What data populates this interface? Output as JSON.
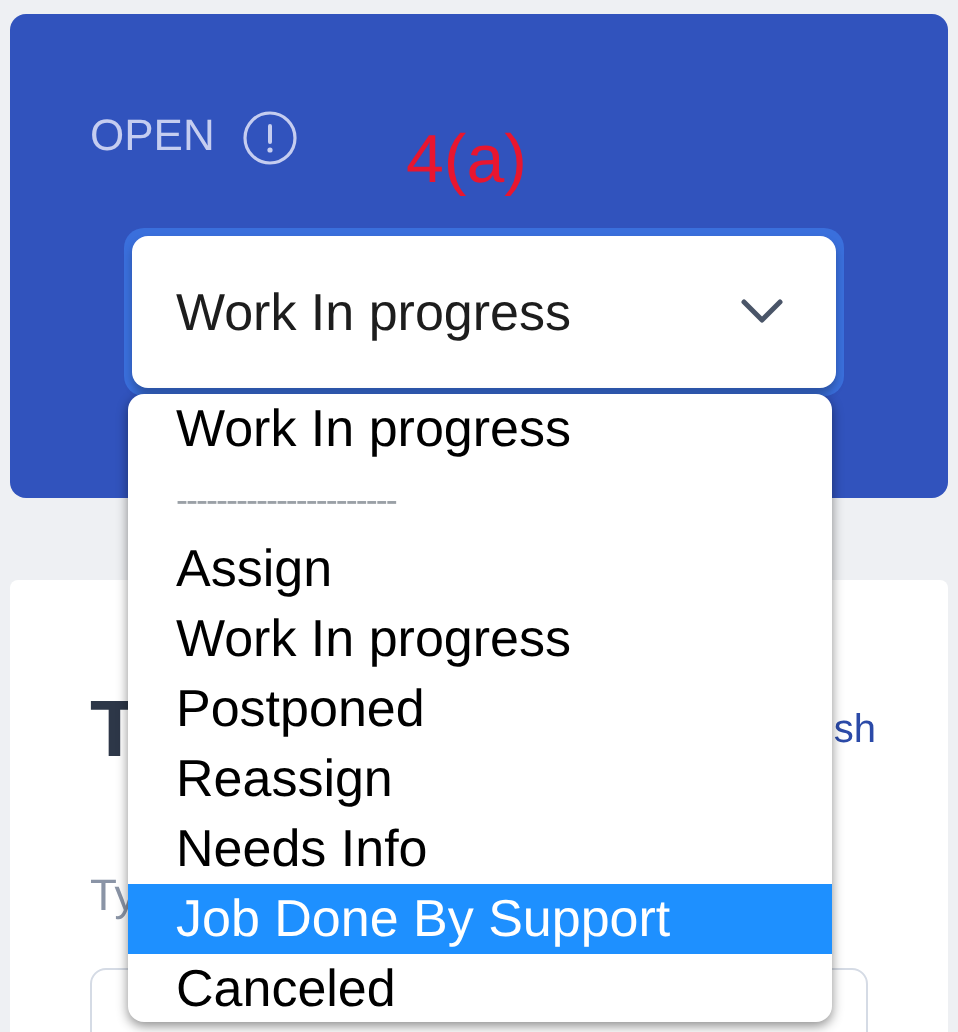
{
  "status_card": {
    "label": "OPEN",
    "annotation": "4(a)",
    "select": {
      "value": "Work In progress",
      "expanded": true
    }
  },
  "dropdown": {
    "options": [
      {
        "label": "Work In progress",
        "kind": "option",
        "selected": false
      },
      {
        "label": "----------------------",
        "kind": "divider"
      },
      {
        "label": "Assign",
        "kind": "option",
        "selected": false
      },
      {
        "label": "Work In progress",
        "kind": "option",
        "selected": false
      },
      {
        "label": "Postponed",
        "kind": "option",
        "selected": false
      },
      {
        "label": "Reassign",
        "kind": "option",
        "selected": false
      },
      {
        "label": "Needs Info",
        "kind": "option",
        "selected": false
      },
      {
        "label": "Job Done By Support",
        "kind": "option",
        "selected": true
      },
      {
        "label": "Canceled",
        "kind": "option",
        "selected": false
      }
    ]
  },
  "details_card": {
    "heading": "T",
    "link": "sh",
    "field_label": "Ty"
  }
}
